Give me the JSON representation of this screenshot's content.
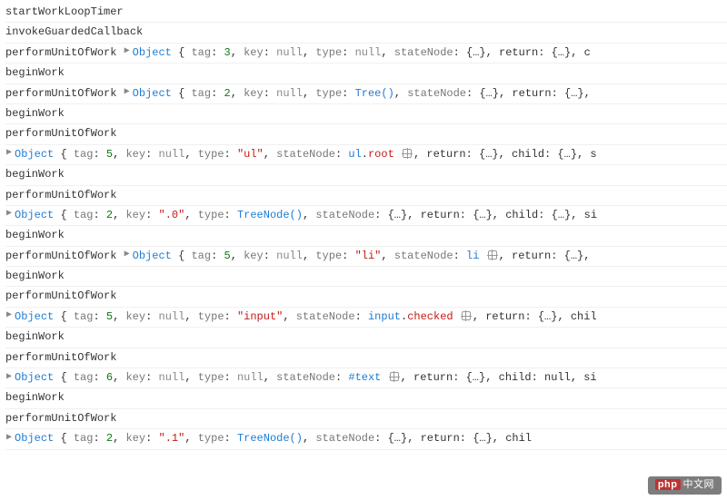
{
  "lines": [
    {
      "kind": "plain",
      "msg": "startWorkLoopTimer"
    },
    {
      "kind": "plain",
      "msg": "invokeGuardedCallback"
    },
    {
      "kind": "obj-right",
      "msg": "performUnitOfWork",
      "obj": {
        "tag_num": 3,
        "key": null,
        "type": {
          "v": null
        },
        "state": {},
        "tail": ", return: {…}, c"
      }
    },
    {
      "kind": "plain",
      "msg": "beginWork"
    },
    {
      "kind": "obj-right",
      "msg": "performUnitOfWork",
      "obj": {
        "tag_num": 2,
        "key": null,
        "type": {
          "fn": "Tree()"
        },
        "state": {},
        "tail": ", return: {…}, "
      }
    },
    {
      "kind": "plain",
      "msg": "beginWork"
    },
    {
      "kind": "plain",
      "msg": "performUnitOfWork"
    },
    {
      "kind": "obj-below",
      "obj": {
        "tag_num": 5,
        "key": null,
        "type": {
          "str": "\"ul\""
        },
        "state": {
          "dom": [
            "ul",
            "root"
          ]
        },
        "tail": ", return: {…}, child: {…}, s"
      }
    },
    {
      "kind": "plain",
      "msg": "beginWork"
    },
    {
      "kind": "plain",
      "msg": "performUnitOfWork"
    },
    {
      "kind": "obj-below",
      "obj": {
        "tag_num": 2,
        "key": "\".0\"",
        "type": {
          "fn": "TreeNode()"
        },
        "state": {},
        "tail": ", return: {…}, child: {…}, si"
      }
    },
    {
      "kind": "plain",
      "msg": "beginWork"
    },
    {
      "kind": "obj-right",
      "msg": "performUnitOfWork",
      "obj": {
        "tag_num": 5,
        "key": null,
        "type": {
          "str": "\"li\""
        },
        "state": {
          "domPlain": "li"
        },
        "tail": ", return: {…}, "
      }
    },
    {
      "kind": "plain",
      "msg": "beginWork"
    },
    {
      "kind": "plain",
      "msg": "performUnitOfWork"
    },
    {
      "kind": "obj-below",
      "obj": {
        "tag_num": 5,
        "key": null,
        "type": {
          "str": "\"input\""
        },
        "state": {
          "dom": [
            "input",
            "checked"
          ]
        },
        "tail": ", return: {…}, chil"
      }
    },
    {
      "kind": "plain",
      "msg": "beginWork"
    },
    {
      "kind": "plain",
      "msg": "performUnitOfWork"
    },
    {
      "kind": "obj-below",
      "obj": {
        "tag_num": 6,
        "key": null,
        "type": {
          "v": null
        },
        "state": {
          "hash": "#text"
        },
        "tail": ", return: {…}, child: null, si"
      }
    },
    {
      "kind": "plain",
      "msg": "beginWork"
    },
    {
      "kind": "plain",
      "msg": "performUnitOfWork"
    },
    {
      "kind": "obj-below",
      "obj": {
        "tag_num": 2,
        "key": "\".1\"",
        "type": {
          "fn": "TreeNode()"
        },
        "state": {},
        "tail": ", return: {…}, chil"
      }
    }
  ],
  "tokens": {
    "objectLabel": "Object",
    "tag": "tag",
    "key": "key",
    "type": "type",
    "stateNode": "stateNode",
    "nullText": "null",
    "bracesObj": "{…}"
  },
  "watermark": {
    "p": "php",
    "text": "中文网"
  }
}
